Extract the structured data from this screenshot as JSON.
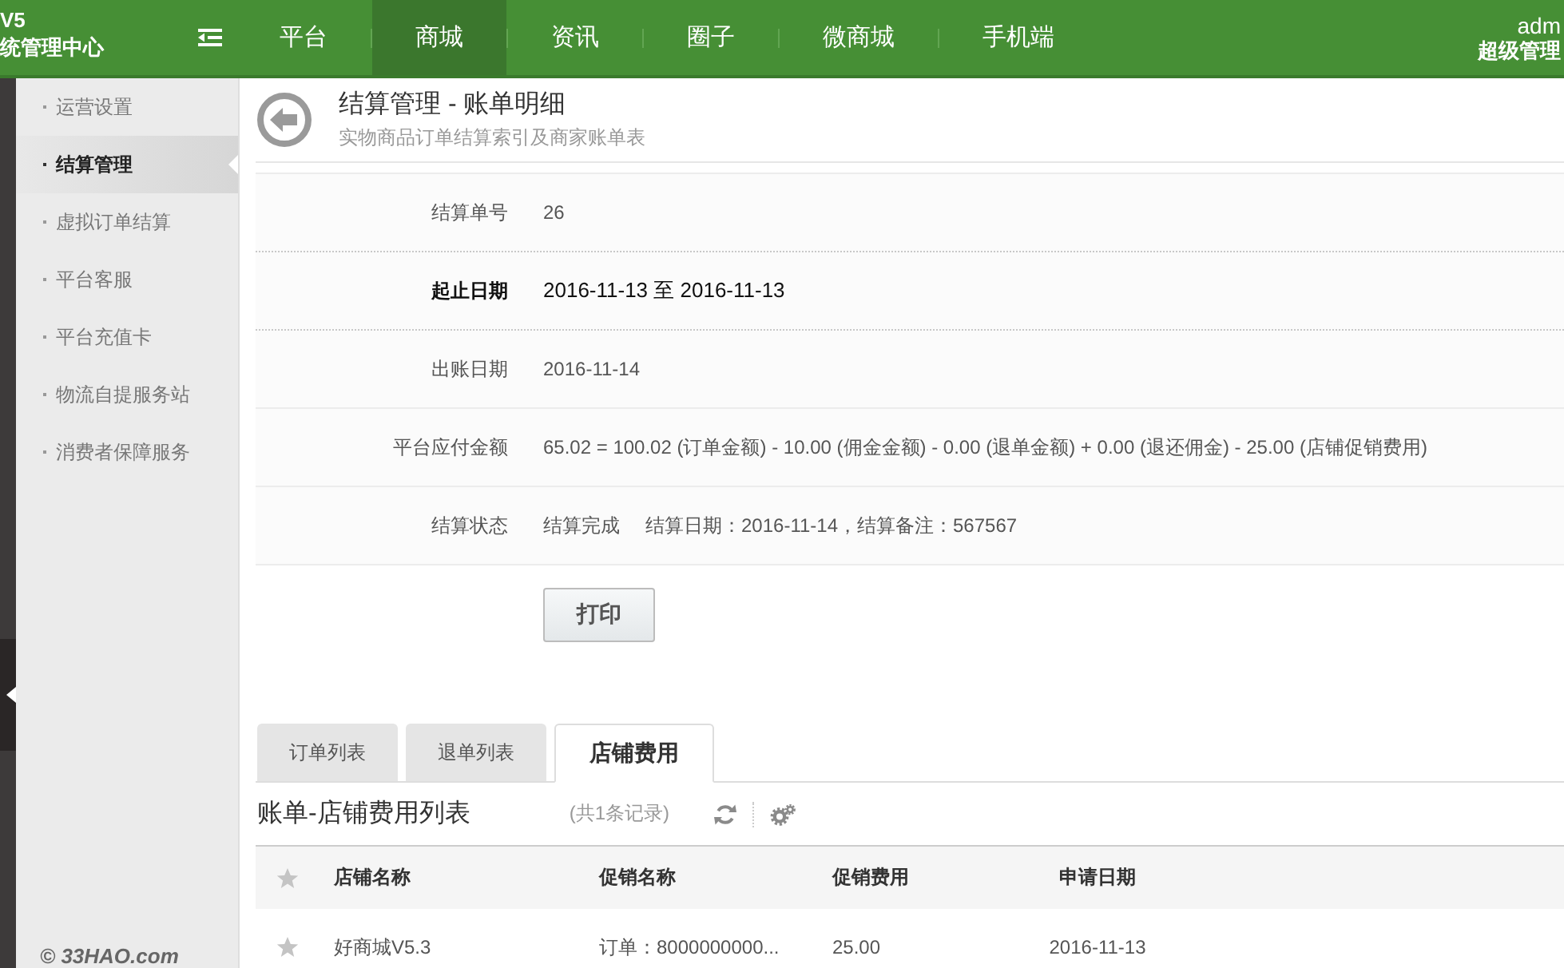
{
  "header": {
    "brand": {
      "version": "V5",
      "title": "统管理中心"
    },
    "nav": [
      {
        "label": "平台",
        "selected": false
      },
      {
        "label": "商城",
        "selected": true
      },
      {
        "label": "资讯",
        "selected": false
      },
      {
        "label": "圈子",
        "selected": false
      },
      {
        "label": "微商城",
        "selected": false
      },
      {
        "label": "手机端",
        "selected": false
      }
    ],
    "user": {
      "name": "adm",
      "role": "超级管理"
    }
  },
  "sidebar": {
    "items": [
      {
        "label": "运营设置",
        "selected": false
      },
      {
        "label": "结算管理",
        "selected": true
      },
      {
        "label": "虚拟订单结算",
        "selected": false
      },
      {
        "label": "平台客服",
        "selected": false
      },
      {
        "label": "平台充值卡",
        "selected": false
      },
      {
        "label": "物流自提服务站",
        "selected": false
      },
      {
        "label": "消费者保障服务",
        "selected": false
      }
    ],
    "footer": "© 33HAO.com"
  },
  "page": {
    "title": "结算管理 - 账单明细",
    "subtitle": "实物商品订单结算索引及商家账单表"
  },
  "details": {
    "rows": [
      {
        "label": "结算单号",
        "value": "26",
        "highlight": false
      },
      {
        "label": "起止日期",
        "value": "2016-11-13 至 2016-11-13",
        "highlight": true
      },
      {
        "label": "出账日期",
        "value": "2016-11-14",
        "highlight": false
      },
      {
        "label": "平台应付金额",
        "value": "65.02 = 100.02 (订单金额) - 10.00 (佣金金额) - 0.00 (退单金额) + 0.00 (退还佣金) - 25.00 (店铺促销费用)",
        "highlight": false
      },
      {
        "label": "结算状态",
        "value": "结算完成",
        "note": "结算日期：2016-11-14，结算备注：567567",
        "highlight": false
      }
    ],
    "print_button": "打印"
  },
  "tabs": [
    {
      "label": "订单列表",
      "selected": false
    },
    {
      "label": "退单列表",
      "selected": false
    },
    {
      "label": "店铺费用",
      "selected": true
    }
  ],
  "list": {
    "title": "账单-店铺费用列表",
    "count": "(共1条记录)",
    "columns": [
      "店铺名称",
      "促销名称",
      "促销费用",
      "申请日期"
    ],
    "rows": [
      {
        "cells": [
          "好商城V5.3",
          "订单：8000000000...",
          "25.00",
          "2016-11-13"
        ]
      }
    ]
  }
}
